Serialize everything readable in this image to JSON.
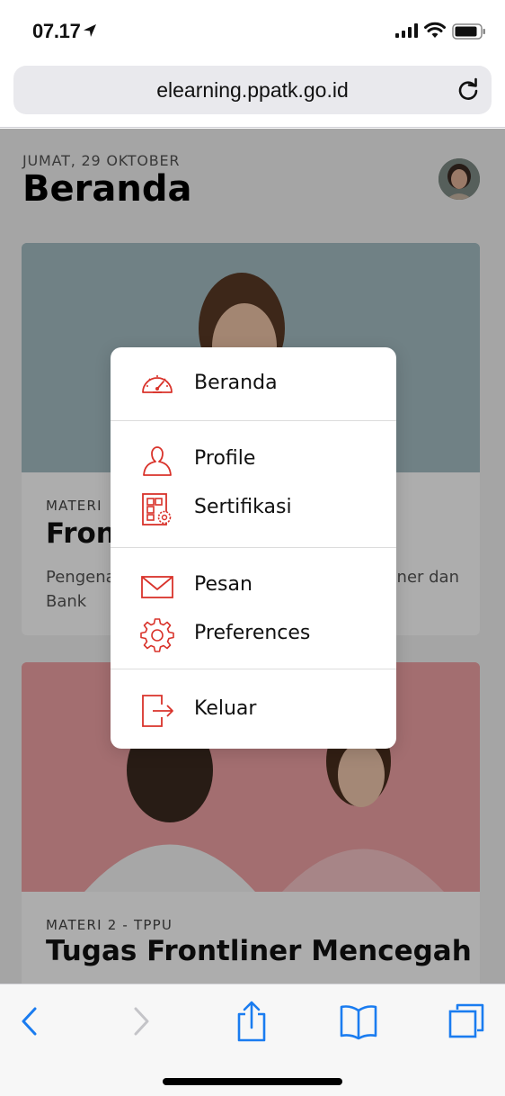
{
  "status_bar": {
    "time": "07.17"
  },
  "browser": {
    "url": "elearning.ppatk.go.id"
  },
  "page": {
    "date_label": "JUMAT, 29 OKTOBER",
    "title": "Beranda"
  },
  "cards": [
    {
      "category": "MATERI 1 - TPPU",
      "title": "Frontliner Bank",
      "description": "Pengenalan tugas dan tanggung jawab Frontliner dan Bank"
    },
    {
      "category": "MATERI 2 - TPPU",
      "title": "Tugas Frontliner Mencegah"
    }
  ],
  "card1_visible": {
    "category_start": "MATERI",
    "title_start": "Front",
    "desc_line1_start": "Pengena",
    "desc_line1_end": "ner dan",
    "desc_line2_start": "Bank"
  },
  "menu": {
    "items": [
      {
        "label": "Beranda",
        "icon": "speedometer-icon"
      },
      {
        "label": "Profile",
        "icon": "user-icon"
      },
      {
        "label": "Sertifikasi",
        "icon": "certificate-icon"
      },
      {
        "label": "Pesan",
        "icon": "envelope-icon"
      },
      {
        "label": "Preferences",
        "icon": "gear-icon"
      },
      {
        "label": "Keluar",
        "icon": "logout-icon"
      }
    ]
  },
  "colors": {
    "accent": "#d9332b",
    "ios_blue": "#1a7cf0",
    "disabled": "#c4c4c8"
  }
}
